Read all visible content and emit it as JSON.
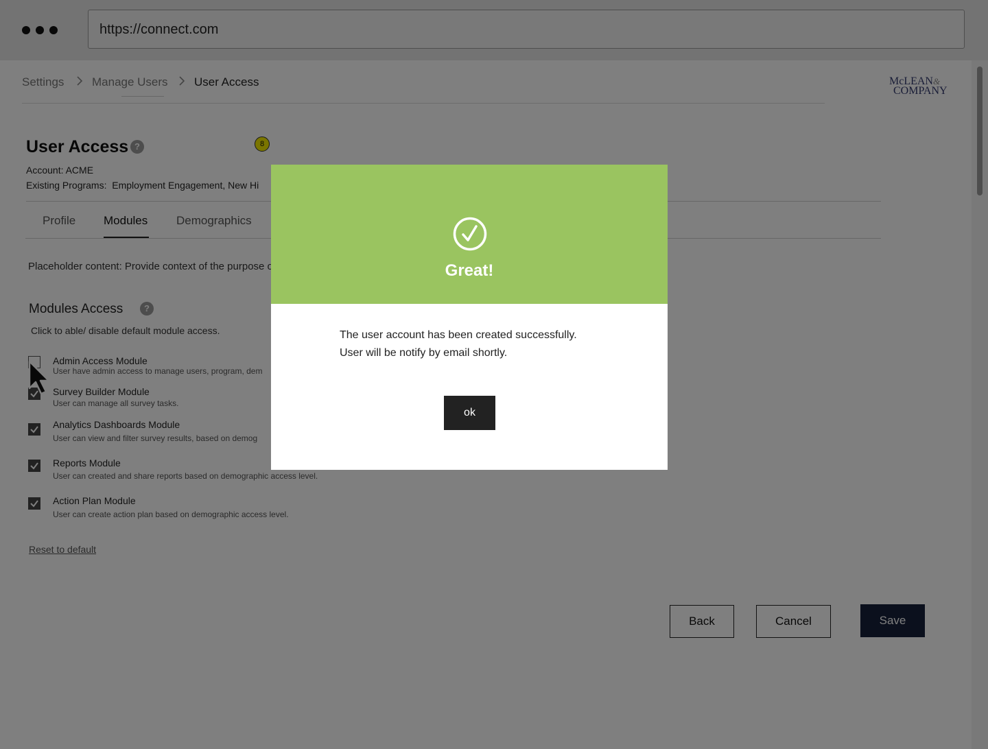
{
  "browser": {
    "url": "https://connect.com"
  },
  "breadcrumb": {
    "items": [
      "Settings",
      "Manage Users",
      "User Access"
    ]
  },
  "logo": {
    "line1": "McLEAN",
    "amp": "&",
    "line2": "COMPANY"
  },
  "header": {
    "title": "User Access",
    "account": "Account: ACME",
    "programs": "Existing Programs:  Employment Engagement, New Hi",
    "pin": "8"
  },
  "tabs": [
    "Profile",
    "Modules",
    "Demographics"
  ],
  "placeholder": "Placeholder content: Provide context of the purpose o",
  "modules_section": {
    "title": "Modules Access",
    "subtitle": "Click to able/ disable default module access.",
    "items": [
      {
        "name": "Admin Access Module",
        "desc": "User have admin access to manage users, program, dem",
        "checked": false
      },
      {
        "name": "Survey Builder Module",
        "desc": "User can manage all survey tasks.",
        "checked": true
      },
      {
        "name": "Analytics Dashboards Module",
        "desc": "User can view and filter survey results, based on demog",
        "checked": true
      },
      {
        "name": "Reports Module",
        "desc": "User can created and share reports based on demographic access level.",
        "checked": true
      },
      {
        "name": "Action Plan Module",
        "desc": "User can create action plan based on demographic access level.",
        "checked": true
      }
    ],
    "reset_label": "Reset to default"
  },
  "footer_buttons": {
    "back": "Back",
    "cancel": "Cancel",
    "save": "Save"
  },
  "modal": {
    "title": "Great!",
    "message_line1": "The user account has been created successfully.",
    "message_line2": "User will be notify by email shortly.",
    "ok_label": "ok",
    "accent_color": "#9ac460"
  },
  "colors": {
    "primary_button": "#16213a",
    "overlay": "rgba(0,0,0,0.5)"
  }
}
